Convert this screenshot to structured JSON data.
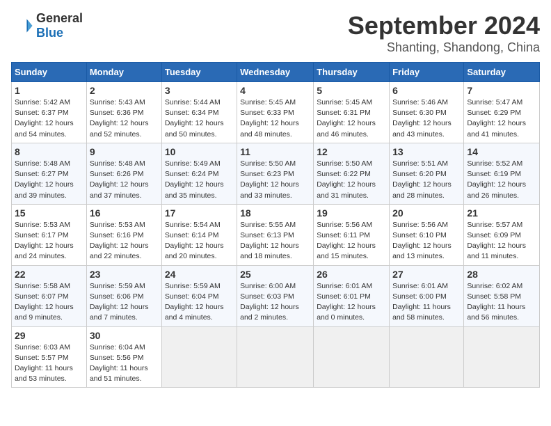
{
  "logo": {
    "line1": "General",
    "line2": "Blue"
  },
  "header": {
    "month": "September 2024",
    "location": "Shanting, Shandong, China"
  },
  "weekdays": [
    "Sunday",
    "Monday",
    "Tuesday",
    "Wednesday",
    "Thursday",
    "Friday",
    "Saturday"
  ],
  "weeks": [
    [
      {
        "day": "1",
        "info": "Sunrise: 5:42 AM\nSunset: 6:37 PM\nDaylight: 12 hours\nand 54 minutes."
      },
      {
        "day": "2",
        "info": "Sunrise: 5:43 AM\nSunset: 6:36 PM\nDaylight: 12 hours\nand 52 minutes."
      },
      {
        "day": "3",
        "info": "Sunrise: 5:44 AM\nSunset: 6:34 PM\nDaylight: 12 hours\nand 50 minutes."
      },
      {
        "day": "4",
        "info": "Sunrise: 5:45 AM\nSunset: 6:33 PM\nDaylight: 12 hours\nand 48 minutes."
      },
      {
        "day": "5",
        "info": "Sunrise: 5:45 AM\nSunset: 6:31 PM\nDaylight: 12 hours\nand 46 minutes."
      },
      {
        "day": "6",
        "info": "Sunrise: 5:46 AM\nSunset: 6:30 PM\nDaylight: 12 hours\nand 43 minutes."
      },
      {
        "day": "7",
        "info": "Sunrise: 5:47 AM\nSunset: 6:29 PM\nDaylight: 12 hours\nand 41 minutes."
      }
    ],
    [
      {
        "day": "8",
        "info": "Sunrise: 5:48 AM\nSunset: 6:27 PM\nDaylight: 12 hours\nand 39 minutes."
      },
      {
        "day": "9",
        "info": "Sunrise: 5:48 AM\nSunset: 6:26 PM\nDaylight: 12 hours\nand 37 minutes."
      },
      {
        "day": "10",
        "info": "Sunrise: 5:49 AM\nSunset: 6:24 PM\nDaylight: 12 hours\nand 35 minutes."
      },
      {
        "day": "11",
        "info": "Sunrise: 5:50 AM\nSunset: 6:23 PM\nDaylight: 12 hours\nand 33 minutes."
      },
      {
        "day": "12",
        "info": "Sunrise: 5:50 AM\nSunset: 6:22 PM\nDaylight: 12 hours\nand 31 minutes."
      },
      {
        "day": "13",
        "info": "Sunrise: 5:51 AM\nSunset: 6:20 PM\nDaylight: 12 hours\nand 28 minutes."
      },
      {
        "day": "14",
        "info": "Sunrise: 5:52 AM\nSunset: 6:19 PM\nDaylight: 12 hours\nand 26 minutes."
      }
    ],
    [
      {
        "day": "15",
        "info": "Sunrise: 5:53 AM\nSunset: 6:17 PM\nDaylight: 12 hours\nand 24 minutes."
      },
      {
        "day": "16",
        "info": "Sunrise: 5:53 AM\nSunset: 6:16 PM\nDaylight: 12 hours\nand 22 minutes."
      },
      {
        "day": "17",
        "info": "Sunrise: 5:54 AM\nSunset: 6:14 PM\nDaylight: 12 hours\nand 20 minutes."
      },
      {
        "day": "18",
        "info": "Sunrise: 5:55 AM\nSunset: 6:13 PM\nDaylight: 12 hours\nand 18 minutes."
      },
      {
        "day": "19",
        "info": "Sunrise: 5:56 AM\nSunset: 6:11 PM\nDaylight: 12 hours\nand 15 minutes."
      },
      {
        "day": "20",
        "info": "Sunrise: 5:56 AM\nSunset: 6:10 PM\nDaylight: 12 hours\nand 13 minutes."
      },
      {
        "day": "21",
        "info": "Sunrise: 5:57 AM\nSunset: 6:09 PM\nDaylight: 12 hours\nand 11 minutes."
      }
    ],
    [
      {
        "day": "22",
        "info": "Sunrise: 5:58 AM\nSunset: 6:07 PM\nDaylight: 12 hours\nand 9 minutes."
      },
      {
        "day": "23",
        "info": "Sunrise: 5:59 AM\nSunset: 6:06 PM\nDaylight: 12 hours\nand 7 minutes."
      },
      {
        "day": "24",
        "info": "Sunrise: 5:59 AM\nSunset: 6:04 PM\nDaylight: 12 hours\nand 4 minutes."
      },
      {
        "day": "25",
        "info": "Sunrise: 6:00 AM\nSunset: 6:03 PM\nDaylight: 12 hours\nand 2 minutes."
      },
      {
        "day": "26",
        "info": "Sunrise: 6:01 AM\nSunset: 6:01 PM\nDaylight: 12 hours\nand 0 minutes."
      },
      {
        "day": "27",
        "info": "Sunrise: 6:01 AM\nSunset: 6:00 PM\nDaylight: 11 hours\nand 58 minutes."
      },
      {
        "day": "28",
        "info": "Sunrise: 6:02 AM\nSunset: 5:58 PM\nDaylight: 11 hours\nand 56 minutes."
      }
    ],
    [
      {
        "day": "29",
        "info": "Sunrise: 6:03 AM\nSunset: 5:57 PM\nDaylight: 11 hours\nand 53 minutes."
      },
      {
        "day": "30",
        "info": "Sunrise: 6:04 AM\nSunset: 5:56 PM\nDaylight: 11 hours\nand 51 minutes."
      },
      {
        "day": "",
        "info": ""
      },
      {
        "day": "",
        "info": ""
      },
      {
        "day": "",
        "info": ""
      },
      {
        "day": "",
        "info": ""
      },
      {
        "day": "",
        "info": ""
      }
    ]
  ]
}
